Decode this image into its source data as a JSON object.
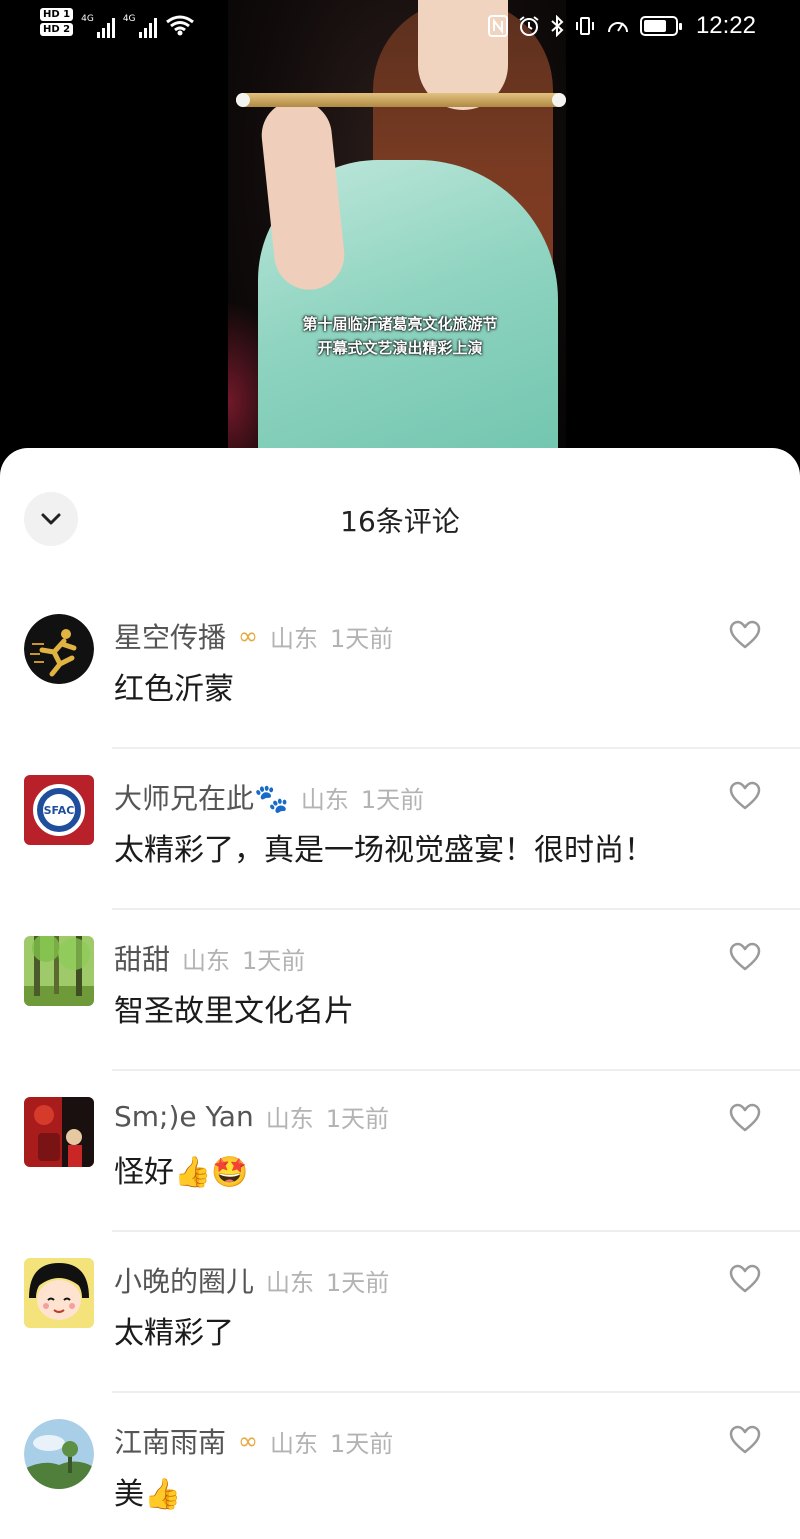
{
  "status_bar": {
    "hd1": "HD 1",
    "hd2": "HD 2",
    "net1": "4G",
    "net2": "4G",
    "time": "12:22",
    "icons": [
      "nfc-icon",
      "alarm-icon",
      "bluetooth-icon",
      "vibrate-icon",
      "data-speed-icon",
      "battery-icon"
    ]
  },
  "video": {
    "caption_line1": "第十届临沂诸葛亮文化旅游节",
    "caption_line2": "开幕式文艺演出精彩上演"
  },
  "sheet": {
    "title": "16条评论",
    "collapse_icon": "chevron-down-icon"
  },
  "comments": [
    {
      "username": "星空传播",
      "vip": "∞",
      "location": "山东",
      "time": "1天前",
      "text": "红色沂蒙",
      "avatar": "running-man-avatar"
    },
    {
      "username": "大师兄在此🐾",
      "vip": "",
      "location": "山东",
      "time": "1天前",
      "text": "太精彩了，真是一场视觉盛宴！很时尚！",
      "avatar": "sfac-logo-avatar"
    },
    {
      "username": "甜甜",
      "vip": "",
      "location": "山东",
      "time": "1天前",
      "text": "智圣故里文化名片",
      "avatar": "forest-avatar"
    },
    {
      "username": "Sm;)e Yan",
      "vip": "",
      "location": "山东",
      "time": "1天前",
      "text": "怪好👍🤩",
      "avatar": "red-lantern-avatar"
    },
    {
      "username": "小晚的圈儿",
      "vip": "",
      "location": "山东",
      "time": "1天前",
      "text": "太精彩了",
      "avatar": "cartoon-girl-avatar"
    },
    {
      "username": "江南雨南",
      "vip": "∞",
      "location": "山东",
      "time": "1天前",
      "text": "美👍",
      "avatar": "sky-trees-avatar"
    }
  ],
  "colors": {
    "sheet_bg": "#ffffff",
    "username": "#555555",
    "meta": "#b3b3b3",
    "vip": "#e5a93c",
    "dress": "#8fd4c0"
  }
}
